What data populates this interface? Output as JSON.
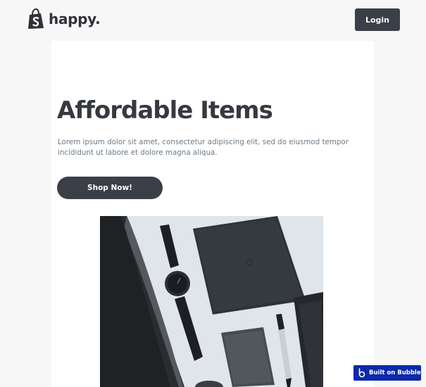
{
  "header": {
    "logo_icon": "shopify-bag-icon",
    "brand_name": "happy.",
    "login_label": "Login"
  },
  "hero": {
    "title": "Affordable Items",
    "description": "Lorem ipsum dolor sit amet, consectetur adipiscing elit, sed do eiusmod tempor incididunt ut labore et dolore magna aliqua.",
    "cta_label": "Shop Now!",
    "image_icon": "product-flatlay-image"
  },
  "badge": {
    "icon": "bubble-logo-icon",
    "label": "Built on Bubble"
  },
  "colors": {
    "page_bg": "#f7f7f8",
    "card_bg": "#ffffff",
    "button_bg": "#3b3f48",
    "text_dark": "#36393f",
    "text_muted": "#6c7a86",
    "badge_bg": "#0c29ab"
  }
}
